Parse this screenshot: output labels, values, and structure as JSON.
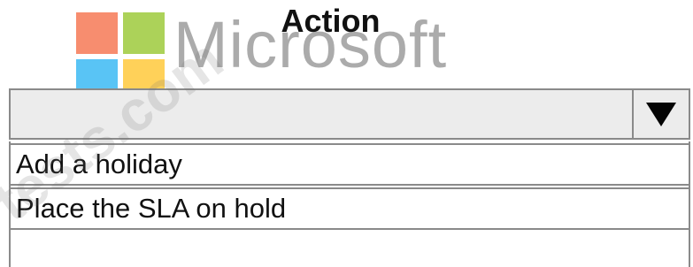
{
  "header": {
    "column_title": "Action",
    "brand_watermark": "Microsoft",
    "watermark_site": "tests.com"
  },
  "dropdown": {
    "selected_value": "",
    "arrow_icon": "triangle-down-icon",
    "options": [
      {
        "label": "Add a holiday"
      },
      {
        "label": "Place the SLA on hold"
      }
    ]
  },
  "colors": {
    "logo_red": "#f25022",
    "logo_green": "#7fba00",
    "logo_blue": "#00a4ef",
    "logo_yellow": "#ffb900",
    "dropdown_bg": "#ececec",
    "border": "#8a8a8a"
  }
}
